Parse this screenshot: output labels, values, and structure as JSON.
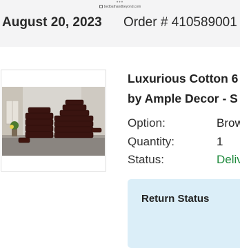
{
  "browser": {
    "url": "bedbathandbeyond.com",
    "menu_dots": "•••"
  },
  "order": {
    "date": "August 20, 2023",
    "number_label": "Order # 410589001"
  },
  "product": {
    "title_line1": "Luxurious Cotton 6",
    "title_line2": "by Ample Decor - S",
    "image_alt": "Brown cotton towel set stacked on a counter"
  },
  "details": {
    "option_label": "Option:",
    "option_value": "Brow",
    "quantity_label": "Quantity:",
    "quantity_value": "1",
    "status_label": "Status:",
    "status_value": "Deliv"
  },
  "return_section": {
    "title": "Return Status"
  },
  "colors": {
    "header_bg": "#f4f4f5",
    "status_green": "#1e8a3c",
    "return_box_bg": "#dbeef8",
    "towel_brown": "#3a1410"
  }
}
